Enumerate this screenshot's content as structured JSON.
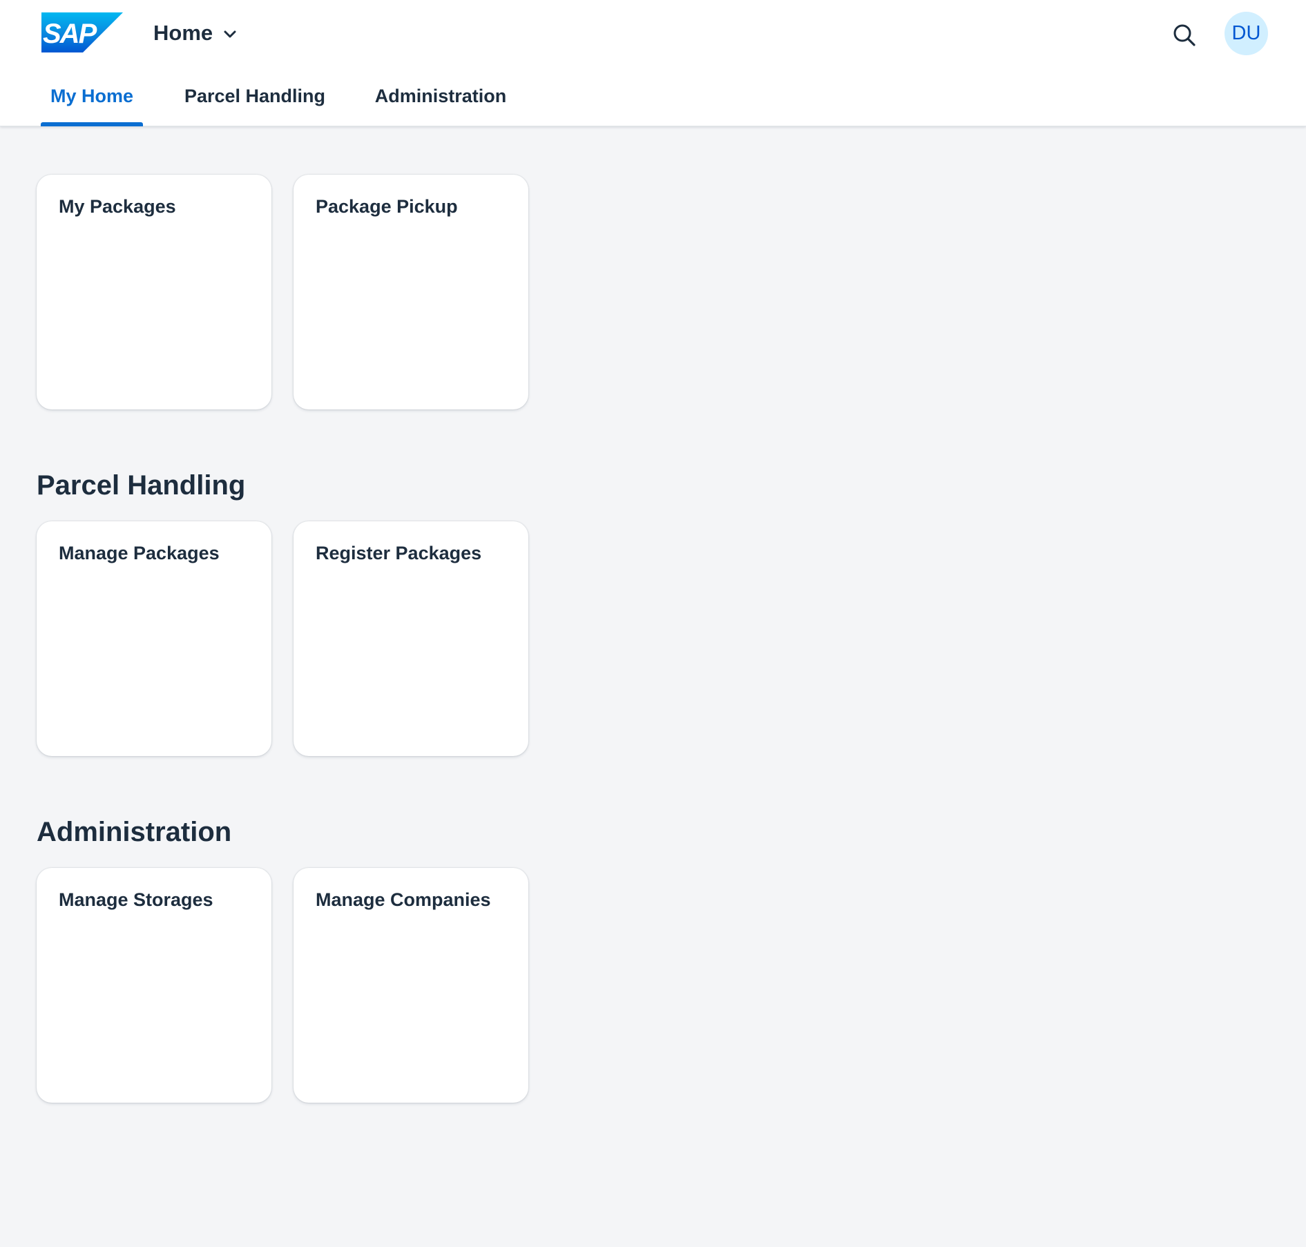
{
  "header": {
    "logo_text": "SAP",
    "app_title": "Home",
    "dropdown_icon": "chevron-down-icon",
    "search_icon": "search-icon",
    "avatar_initials": "DU"
  },
  "tabs": [
    {
      "label": "My Home",
      "active": true
    },
    {
      "label": "Parcel Handling",
      "active": false
    },
    {
      "label": "Administration",
      "active": false
    }
  ],
  "sections": [
    {
      "title": "",
      "tiles": [
        {
          "title": "My Packages"
        },
        {
          "title": "Package Pickup"
        }
      ]
    },
    {
      "title": "Parcel Handling",
      "tiles": [
        {
          "title": "Manage Packages"
        },
        {
          "title": "Register Packages"
        }
      ]
    },
    {
      "title": "Administration",
      "tiles": [
        {
          "title": "Manage Storages"
        },
        {
          "title": "Manage Companies"
        }
      ]
    }
  ],
  "colors": {
    "brand_blue": "#0a6ed1",
    "background": "#f4f5f7",
    "avatar_bg": "#d1efff",
    "text": "#1d2d3e"
  }
}
